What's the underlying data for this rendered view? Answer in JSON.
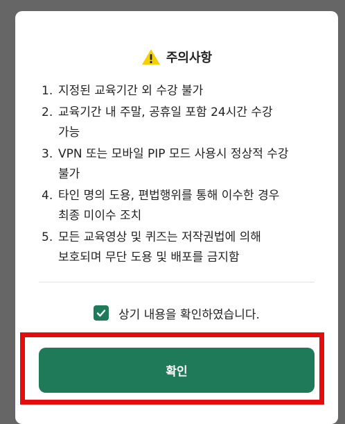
{
  "modal": {
    "title": "주의사항",
    "warning_icon": "warning-triangle-icon",
    "notices": [
      {
        "number": "1.",
        "lines": [
          "지정된 교육기간 외 수강 불가"
        ]
      },
      {
        "number": "2.",
        "lines": [
          "교육기간 내 주말, 공휴일 포함 24시간 수강",
          "가능"
        ]
      },
      {
        "number": "3.",
        "lines": [
          "VPN 또는 모바일 PIP 모드 사용시 정상적 수강",
          "불가"
        ]
      },
      {
        "number": "4.",
        "lines": [
          "타인 명의 도용, 편법행위를 통해 이수한 경우",
          "최종 미이수 조치"
        ]
      },
      {
        "number": "5.",
        "lines": [
          "모든 교육영상 및 퀴즈는 저작권법에 의해",
          "보호되며 무단 도용 및 배포를 금지함"
        ]
      }
    ],
    "checkbox": {
      "checked": true,
      "label": "상기 내용을 확인하였습니다.",
      "icon": "checkmark-icon"
    },
    "confirm_button_label": "확인"
  },
  "colors": {
    "backdrop": "#666666",
    "accent_green": "#1f7a59",
    "warning_yellow": "#f5d000",
    "highlight_red": "#e30d0d"
  }
}
